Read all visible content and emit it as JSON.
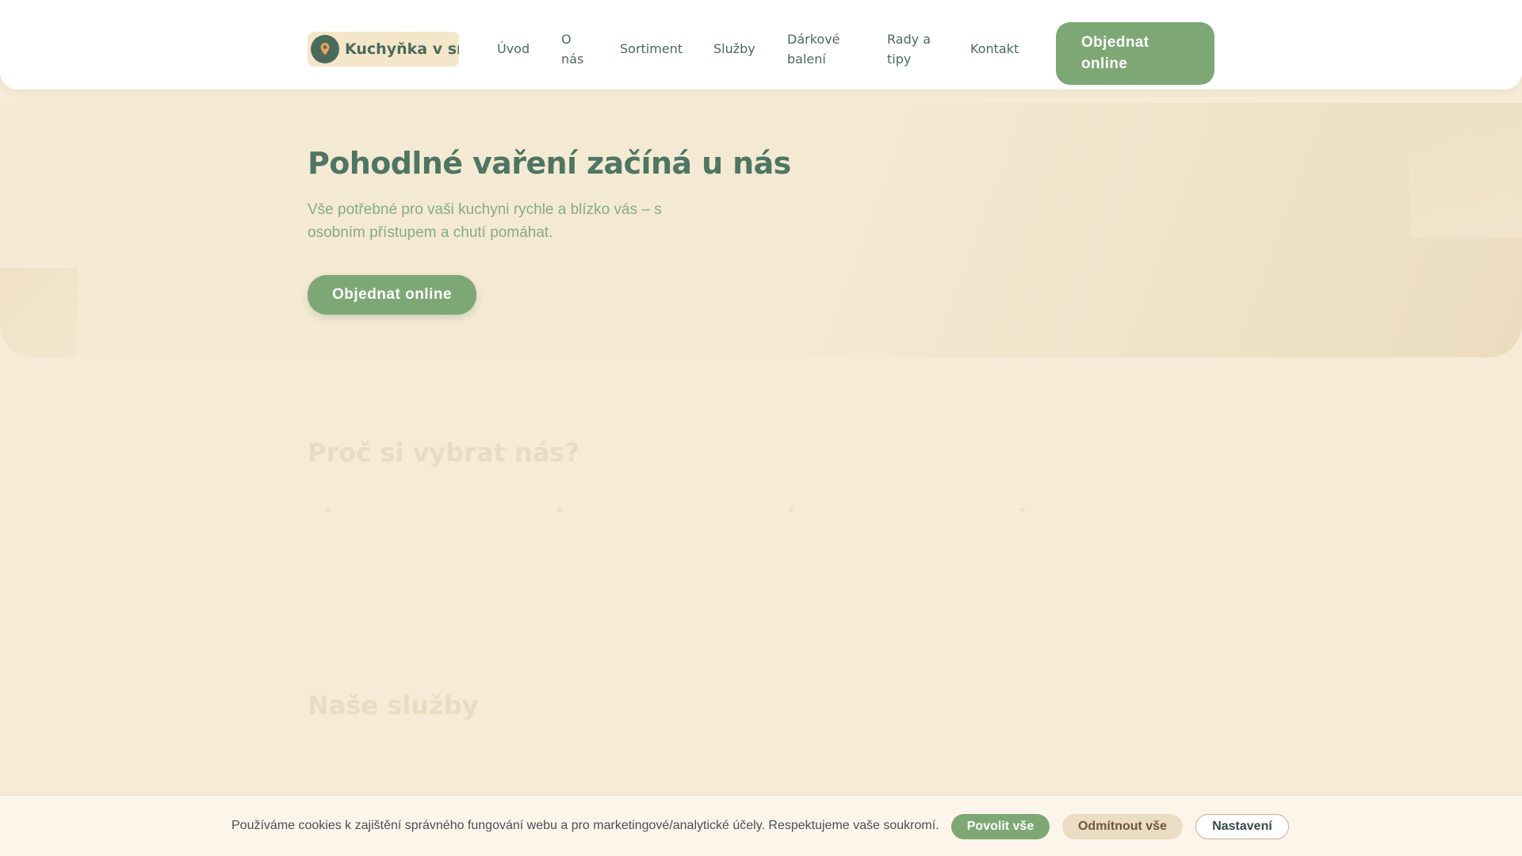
{
  "header": {
    "logo": {
      "text": "Kuchyňka v srdci",
      "icon": "pin-icon"
    },
    "nav": [
      {
        "label": "Úvod"
      },
      {
        "label": "O nás"
      },
      {
        "label": "Sortiment"
      },
      {
        "label": "Služby"
      },
      {
        "label": "Dárkové balení"
      },
      {
        "label": "Rady a tipy"
      },
      {
        "label": "Kontakt"
      }
    ],
    "cta_label": "Objednat online"
  },
  "hero": {
    "title": "Pohodlné vaření začíná u nás",
    "subtitle": "Vše potřebné pro vaši kuchyni rychle a blízko vás – s osobním přístupem a chutí pomáhat.",
    "cta_label": "Objednat online"
  },
  "why_section": {
    "title": "Proč si vybrat nás?"
  },
  "services_section": {
    "title": "Naše služby"
  },
  "cookie_bar": {
    "text": "Používáme cookies k zajištění správného fungování webu a pro marketingové/analytické účely. Respektujeme vaše soukromí.",
    "allow_label": "Povolit vše",
    "reject_label": "Odmítnout vše",
    "settings_label": "Nastavení"
  },
  "colors": {
    "primary_green": "#7ea776",
    "dark_green": "#4a6b5c",
    "background": "#f5ebd6"
  }
}
